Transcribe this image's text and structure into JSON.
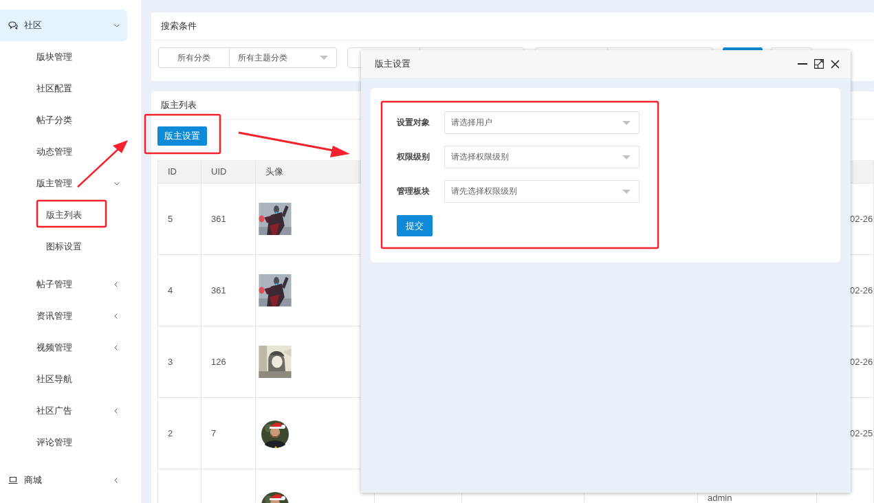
{
  "sidebar": {
    "items": [
      {
        "label": "社区",
        "selected": true,
        "expanded": true,
        "children": [
          {
            "label": "版块管理"
          },
          {
            "label": "社区配置"
          },
          {
            "label": "帖子分类"
          },
          {
            "label": "动态管理"
          },
          {
            "label": "版主管理",
            "expanded": true,
            "children": [
              {
                "label": "版主列表"
              },
              {
                "label": "图标设置"
              }
            ]
          },
          {
            "label": "帖子管理",
            "expanded": false
          },
          {
            "label": "资讯管理",
            "expanded": false
          },
          {
            "label": "视频管理",
            "expanded": false
          },
          {
            "label": "社区导航"
          },
          {
            "label": "社区广告",
            "expanded": false
          },
          {
            "label": "评论管理"
          }
        ]
      },
      {
        "label": "商城",
        "selected": false,
        "expanded": false
      }
    ]
  },
  "search_panel": {
    "title": "搜索条件",
    "filters": [
      {
        "label": "所有分类",
        "value": "所有主题分类"
      }
    ]
  },
  "list_panel": {
    "title": "版主列表",
    "button": "版主设置",
    "table": {
      "columns": [
        "ID",
        "UID",
        "头像"
      ],
      "rows": [
        {
          "id": "5",
          "uid": "361",
          "date": "02-26"
        },
        {
          "id": "4",
          "uid": "361",
          "date": "02-26"
        },
        {
          "id": "3",
          "uid": "126",
          "date": "02-26"
        },
        {
          "id": "2",
          "uid": "7",
          "date": "02-25"
        },
        {
          "column_7": "admin"
        }
      ]
    }
  },
  "dialog": {
    "title": "版主设置",
    "fields": [
      {
        "label": "设置对象",
        "placeholder": "请选择用户"
      },
      {
        "label": "权限级别",
        "placeholder": "请选择权限级别"
      },
      {
        "label": "管理板块",
        "placeholder": "请先选择权限级别"
      }
    ],
    "submit": "提交"
  }
}
